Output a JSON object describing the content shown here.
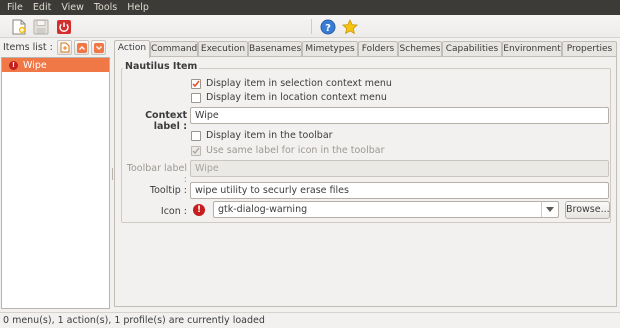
{
  "menubar": {
    "items": [
      "File",
      "Edit",
      "View",
      "Tools",
      "Help"
    ]
  },
  "toolbar": {
    "icons": [
      "new-document-icon",
      "save-icon",
      "quit-icon",
      "help-icon",
      "favorite-star-icon"
    ]
  },
  "left_pane": {
    "label": "Items list :",
    "items": [
      {
        "label": "Wipe",
        "icon": "warning-icon",
        "selected": true
      }
    ]
  },
  "tabs": [
    "Action",
    "Command",
    "Execution",
    "Basenames",
    "Mimetypes",
    "Folders",
    "Schemes",
    "Capabilities",
    "Environment",
    "Properties"
  ],
  "active_tab": "Action",
  "action": {
    "frame_title": "Nautilus Item",
    "selection_menu": {
      "label": "Display item in selection context menu",
      "checked": true
    },
    "location_menu": {
      "label": "Display item in location context menu",
      "checked": false
    },
    "context_label": {
      "label": "Context label :",
      "value": "Wipe"
    },
    "toolbar_display": {
      "label": "Display item in the toolbar",
      "checked": false
    },
    "same_label": {
      "label": "Use same label for icon in the toolbar",
      "checked": true,
      "disabled": true
    },
    "toolbar_label": {
      "label": "Toolbar label :",
      "value": "Wipe"
    },
    "tooltip": {
      "label": "Tooltip :",
      "value": "wipe utility to securly erase files"
    },
    "icon": {
      "label": "Icon :",
      "value": "gtk-dialog-warning",
      "browse_label": "Browse..."
    }
  },
  "status": {
    "text": "0 menu(s), 1 action(s), 1 profile(s) are currently loaded"
  },
  "colors": {
    "selection": "#f07746",
    "menubar": "#3c3b37",
    "warning": "#c61e1e",
    "check": "#e1572a"
  }
}
